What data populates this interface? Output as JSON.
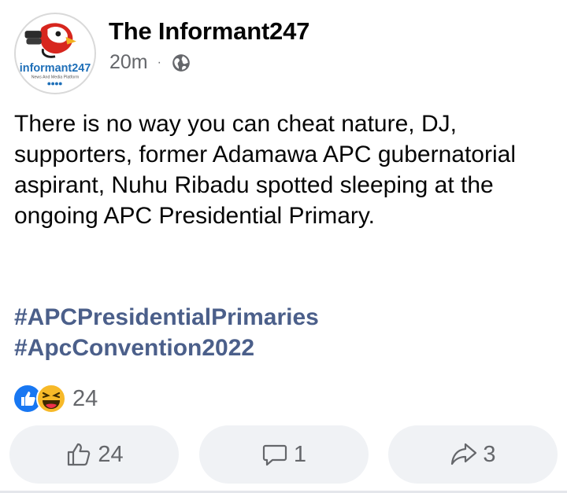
{
  "post": {
    "page_name": "The Informant247",
    "time": "20m",
    "separator": "·",
    "privacy_icon": "globe-icon",
    "text": "There is no way you can cheat nature, DJ, supporters, former Adamawa APC gubernatorial aspirant, Nuhu Ribadu spotted sleeping at the ongoing APC Presidential Primary.",
    "hashtags": [
      "#APCPresidentialPrimaries",
      "#ApcConvention2022"
    ]
  },
  "avatar": {
    "logo_text": "informant247",
    "logo_tagline": "News And Media Platform"
  },
  "reactions": {
    "icons": [
      "like-icon",
      "haha-icon"
    ],
    "count": "24"
  },
  "actions": {
    "like_count": "24",
    "comment_count": "1",
    "share_count": "3"
  },
  "colors": {
    "hashtag": "#4b5f8a",
    "muted": "#65676b",
    "button_bg": "#f0f2f5",
    "like_blue": "#1877f2",
    "haha_yellow": "#f7b928"
  }
}
